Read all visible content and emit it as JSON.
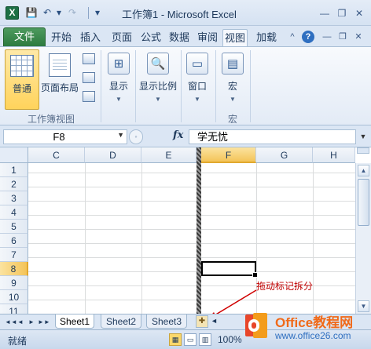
{
  "titlebar": {
    "app_icon": "X",
    "title": "工作簿1 - Microsoft Excel",
    "qat": [
      {
        "name": "save-icon",
        "glyph": "💾"
      },
      {
        "name": "undo-icon",
        "glyph": "↶"
      },
      {
        "name": "redo-icon",
        "glyph": "↷"
      },
      {
        "name": "customize-qat-icon",
        "glyph": "▾"
      }
    ],
    "window_buttons": [
      {
        "name": "minimize-icon",
        "glyph": "—"
      },
      {
        "name": "restore-icon",
        "glyph": "❐"
      },
      {
        "name": "close-icon",
        "glyph": "✕"
      }
    ]
  },
  "ribbon_tabs": {
    "file": "文件",
    "tabs": [
      "开始",
      "插入",
      "页面布",
      "公式",
      "数据",
      "审阅",
      "视图",
      "加载项"
    ],
    "active": "视图",
    "icons": [
      {
        "name": "minimize-ribbon-icon",
        "glyph": "^"
      },
      {
        "name": "help-icon",
        "glyph": "?"
      },
      {
        "name": "doc-minimize-icon",
        "glyph": "—"
      },
      {
        "name": "doc-restore-icon",
        "glyph": "❐"
      },
      {
        "name": "doc-close-icon",
        "glyph": "✕"
      }
    ]
  },
  "ribbon": {
    "normal": "普通",
    "page_layout": "页面布局",
    "show": "显示",
    "zoom": "显示比例",
    "window": "窗口",
    "macro": "宏",
    "group_workbook_views": "工作簿视图",
    "group_macros": "宏"
  },
  "formula_bar": {
    "name_box": "F8",
    "fx": "fx",
    "value": "学无忧"
  },
  "grid": {
    "columns": [
      "C",
      "D",
      "E",
      "F",
      "G",
      "H"
    ],
    "selected_column": "F",
    "rows": [
      "1",
      "2",
      "3",
      "4",
      "5",
      "6",
      "7",
      "8",
      "9",
      "10",
      "11"
    ],
    "selected_row": "8"
  },
  "annotation": "拖动标记拆分",
  "sheet_tabs": {
    "tabs": [
      "Sheet1",
      "Sheet2",
      "Sheet3"
    ],
    "active": "Sheet1",
    "nav": [
      "◄◄",
      "◄",
      "►",
      "►►"
    ]
  },
  "status_bar": {
    "ready": "就绪",
    "zoom": "100%"
  },
  "watermark": {
    "title": "Office教程网",
    "url": "www.office26.com",
    "logo_colors": [
      "#e8462a",
      "#f39c1b"
    ]
  },
  "colors": {
    "selected_header": "#f4c458",
    "file_tab": "#2c7a3f",
    "annotation": "#c00000"
  }
}
